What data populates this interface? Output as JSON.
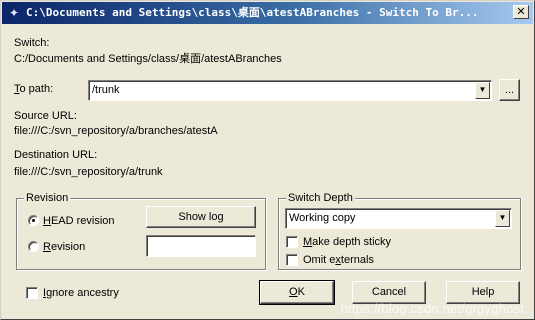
{
  "window": {
    "title": "C:\\Documents and Settings\\class\\桌面\\atestABranches - Switch To Br...",
    "close_glyph": "✕"
  },
  "switch": {
    "label": "Switch:",
    "path": "C:/Documents and Settings/class/桌面/atestABranches"
  },
  "to_path": {
    "label_key": "T",
    "label_rest": "o path:",
    "value": "/trunk",
    "browse_label": "..."
  },
  "source": {
    "label": "Source URL:",
    "url": "file:///C:/svn_repository/a/branches/atestA"
  },
  "destination": {
    "label": "Destination URL:",
    "url": "file:///C:/svn_repository/a/trunk"
  },
  "revision": {
    "group_label": "Revision",
    "head_key": "H",
    "head_rest": "EAD revision",
    "rev_key": "R",
    "rev_rest": "evision",
    "show_log_label": "Show log",
    "rev_value": "",
    "selected": "head"
  },
  "depth": {
    "group_label": "Switch Depth",
    "selected": "Working copy",
    "sticky_key": "M",
    "sticky_rest": "ake depth sticky",
    "omit_pre": "Omit e",
    "omit_key": "x",
    "omit_rest": "ternals",
    "sticky_checked": false,
    "omit_checked": false
  },
  "ignore": {
    "key": "I",
    "rest": "gnore ancestry",
    "checked": false
  },
  "buttons": {
    "ok_key": "O",
    "ok_rest": "K",
    "cancel_label": "Cancel",
    "help_label": "Help"
  },
  "watermark": "https://blog.csdn.net/grgyghost",
  "icons": {
    "app": "tortoisesvn-icon",
    "arrow": "▼"
  }
}
